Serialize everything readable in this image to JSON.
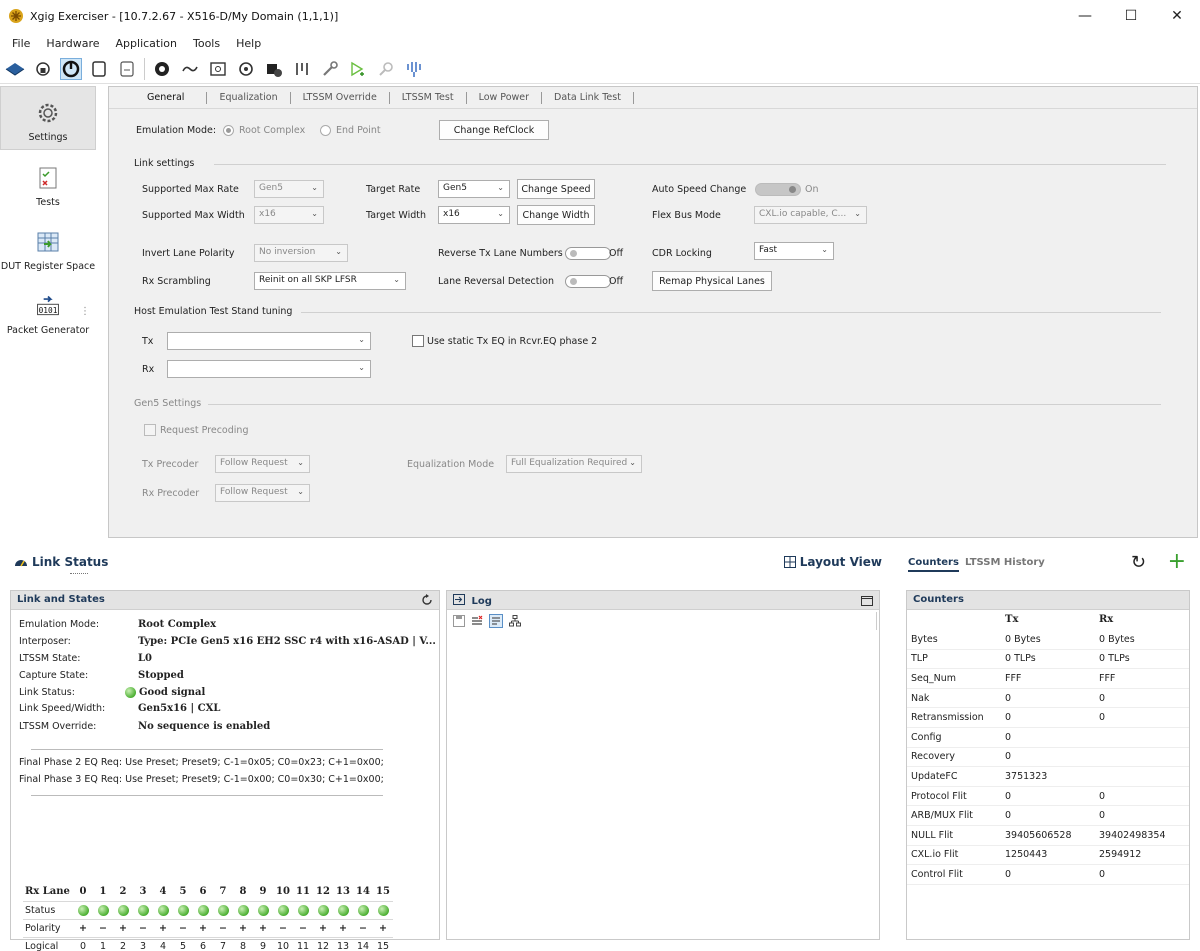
{
  "window": {
    "title": "Xgig Exerciser - [10.7.2.67 - X516-D/My Domain (1,1,1)]",
    "minimize": "—",
    "maximize": "☐",
    "close": "✕"
  },
  "menu": [
    "File",
    "Hardware",
    "Application",
    "Tools",
    "Help"
  ],
  "sidebar": {
    "items": [
      {
        "label": "Settings"
      },
      {
        "label": "Tests"
      },
      {
        "label": "DUT Register Space"
      },
      {
        "label": "Packet Generator",
        "icon_text": "0101"
      }
    ],
    "grip": "⋮"
  },
  "tabs": [
    "General",
    "Equalization",
    "LTSSM Override",
    "LTSSM Test",
    "Low Power",
    "Data Link Test"
  ],
  "general": {
    "emulation_mode_label": "Emulation Mode:",
    "root_complex": "Root Complex",
    "end_point": "End Point",
    "change_refclock": "Change RefClock",
    "link_settings": "Link settings",
    "supported_max_rate_label": "Supported Max Rate",
    "supported_max_rate": "Gen5",
    "target_rate_label": "Target Rate",
    "target_rate": "Gen5",
    "change_speed": "Change Speed",
    "auto_speed_change_label": "Auto Speed Change",
    "auto_speed_change": "On",
    "supported_max_width_label": "Supported Max Width",
    "supported_max_width": "x16",
    "target_width_label": "Target Width",
    "target_width": "x16",
    "change_width": "Change Width",
    "flex_bus_mode_label": "Flex Bus Mode",
    "flex_bus_mode": "CXL.io capable, C...",
    "invert_lane_polarity_label": "Invert Lane Polarity",
    "invert_lane_polarity": "No inversion",
    "reverse_tx_label": "Reverse Tx Lane Numbers",
    "reverse_tx": "Off",
    "cdr_locking_label": "CDR Locking",
    "cdr_locking": "Fast",
    "rx_scrambling_label": "Rx Scrambling",
    "rx_scrambling": "Reinit on all SKP LFSR",
    "lane_reversal_label": "Lane Reversal Detection",
    "lane_reversal": "Off",
    "remap_lanes": "Remap Physical Lanes",
    "host_tuning": "Host Emulation Test Stand tuning",
    "tx_label": "Tx",
    "rx_label": "Rx",
    "use_static_tx": "Use static Tx EQ in Rcvr.EQ phase 2",
    "gen5_settings": "Gen5 Settings",
    "request_precoding": "Request Precoding",
    "tx_precoder_label": "Tx Precoder",
    "tx_precoder": "Follow Request",
    "rx_precoder_label": "Rx Precoder",
    "rx_precoder": "Follow Request",
    "eq_mode_label": "Equalization Mode",
    "eq_mode": "Full Equalization Required",
    "dropdown_arrow": "⌄"
  },
  "link_status": {
    "title": "Link Status",
    "layout_view": "Layout View",
    "panel_title": "Link and States",
    "rows": [
      {
        "key": "Emulation Mode:",
        "value": "Root Complex"
      },
      {
        "key": "Interposer:",
        "value": "Type: PCIe Gen5 x16 EH2 SSC r4 with x16-ASAD | V..."
      },
      {
        "key": "LTSSM State:",
        "value": "L0"
      },
      {
        "key": "Capture State:",
        "value": "Stopped"
      },
      {
        "key": "Link Status:",
        "value": "Good signal"
      },
      {
        "key": "Link Speed/Width:",
        "value": "Gen5x16 | CXL"
      },
      {
        "key": "LTSSM Override:",
        "value": "No sequence is enabled"
      }
    ],
    "eq_lines": [
      "Final Phase 2 EQ Req: Use Preset; Preset9; C-1=0x05; C0=0x23; C+1=0x00;",
      "Final Phase 3 EQ Req: Use Preset; Preset9; C-1=0x00; C0=0x30; C+1=0x00;"
    ],
    "lanes": {
      "header": "Rx Lane",
      "numbers": [
        "0",
        "1",
        "2",
        "3",
        "4",
        "5",
        "6",
        "7",
        "8",
        "9",
        "10",
        "11",
        "12",
        "13",
        "14",
        "15"
      ],
      "status_label": "Status",
      "polarity_label": "Polarity",
      "polarity": [
        "+",
        "−",
        "+",
        "−",
        "+",
        "−",
        "+",
        "−",
        "+",
        "+",
        "−",
        "−",
        "+",
        "+",
        "−",
        "+"
      ],
      "logical_label": "Logical",
      "logical": [
        "0",
        "1",
        "2",
        "3",
        "4",
        "5",
        "6",
        "7",
        "8",
        "9",
        "10",
        "11",
        "12",
        "13",
        "14",
        "15"
      ]
    }
  },
  "log": {
    "title": "Log"
  },
  "counters": {
    "tab_counters": "Counters",
    "tab_history": "LTSSM History",
    "refresh": "↻",
    "add": "+",
    "panel_title": "Counters",
    "col_tx": "Tx",
    "col_rx": "Rx",
    "rows": [
      {
        "name": "Bytes",
        "tx": "0 Bytes",
        "rx": "0 Bytes"
      },
      {
        "name": "TLP",
        "tx": "0 TLPs",
        "rx": "0 TLPs"
      },
      {
        "name": "Seq_Num",
        "tx": "FFF",
        "rx": "FFF"
      },
      {
        "name": "Nak",
        "tx": "0",
        "rx": "0"
      },
      {
        "name": "Retransmission",
        "tx": "0",
        "rx": "0"
      },
      {
        "name": "Config",
        "tx": "0",
        "rx": ""
      },
      {
        "name": "Recovery",
        "tx": "0",
        "rx": ""
      },
      {
        "name": "UpdateFC",
        "tx": "3751323",
        "rx": ""
      },
      {
        "name": "Protocol Flit",
        "tx": "0",
        "rx": "0"
      },
      {
        "name": "ARB/MUX Flit",
        "tx": "0",
        "rx": "0"
      },
      {
        "name": "NULL Flit",
        "tx": "39405606528",
        "rx": "39402498354"
      },
      {
        "name": "CXL.io Flit",
        "tx": "1250443",
        "rx": "2594912"
      },
      {
        "name": "Control Flit",
        "tx": "0",
        "rx": "0"
      }
    ]
  }
}
